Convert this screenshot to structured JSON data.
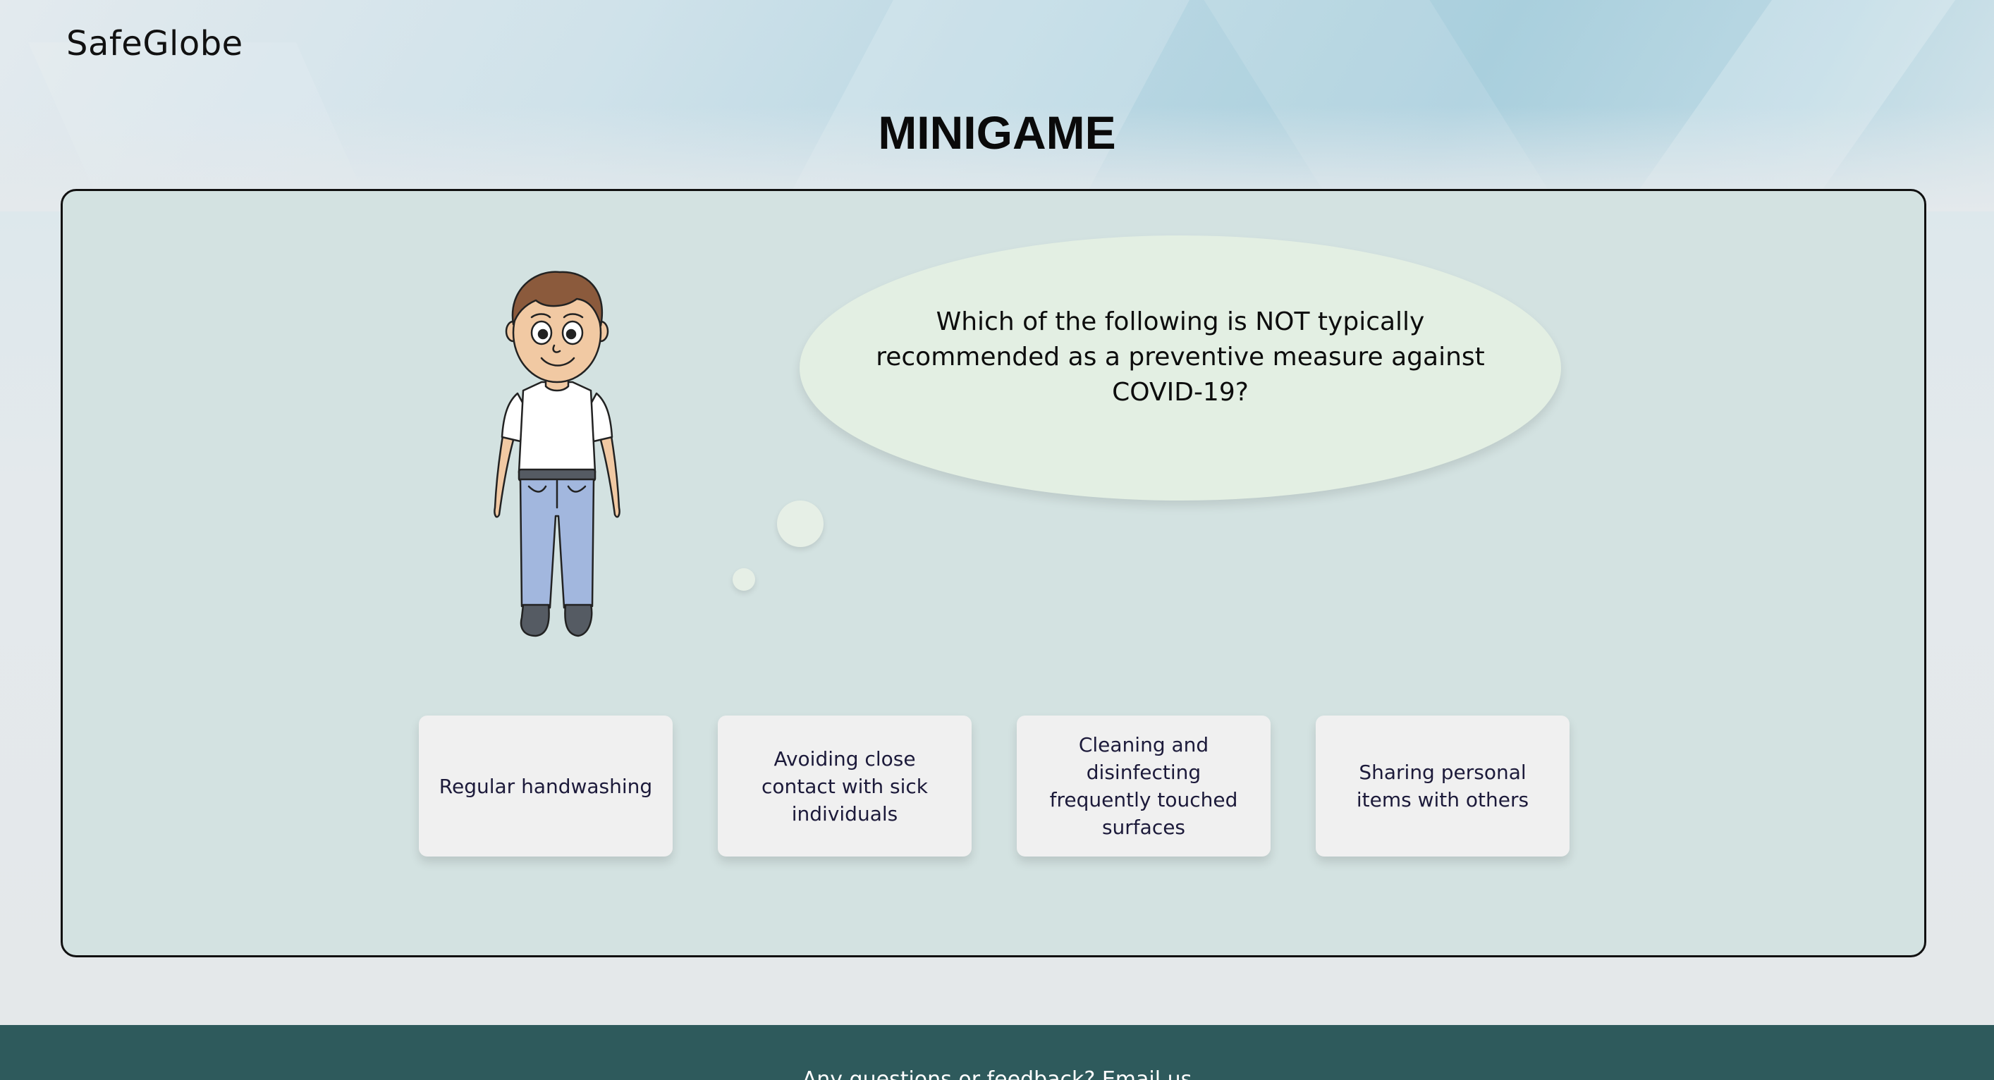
{
  "brand": {
    "name": "SafeGlobe"
  },
  "page": {
    "title": "MINIGAME"
  },
  "game": {
    "question": "Which of the following is NOT typically recommended as a preventive measure against COVID-19?",
    "answers": [
      {
        "label": "Regular handwashing"
      },
      {
        "label": "Avoiding close contact with sick individuals"
      },
      {
        "label": "Cleaning and disinfecting frequently touched surfaces"
      },
      {
        "label": "Sharing personal items with others"
      }
    ]
  },
  "footer": {
    "text": "Any questions or feedback? Email us"
  },
  "colors": {
    "panel_background": "#d3e2e1",
    "thought_bubble": "#e3efe3",
    "answer_card": "#f0f0f0",
    "footer_background": "#2e5a5c"
  }
}
